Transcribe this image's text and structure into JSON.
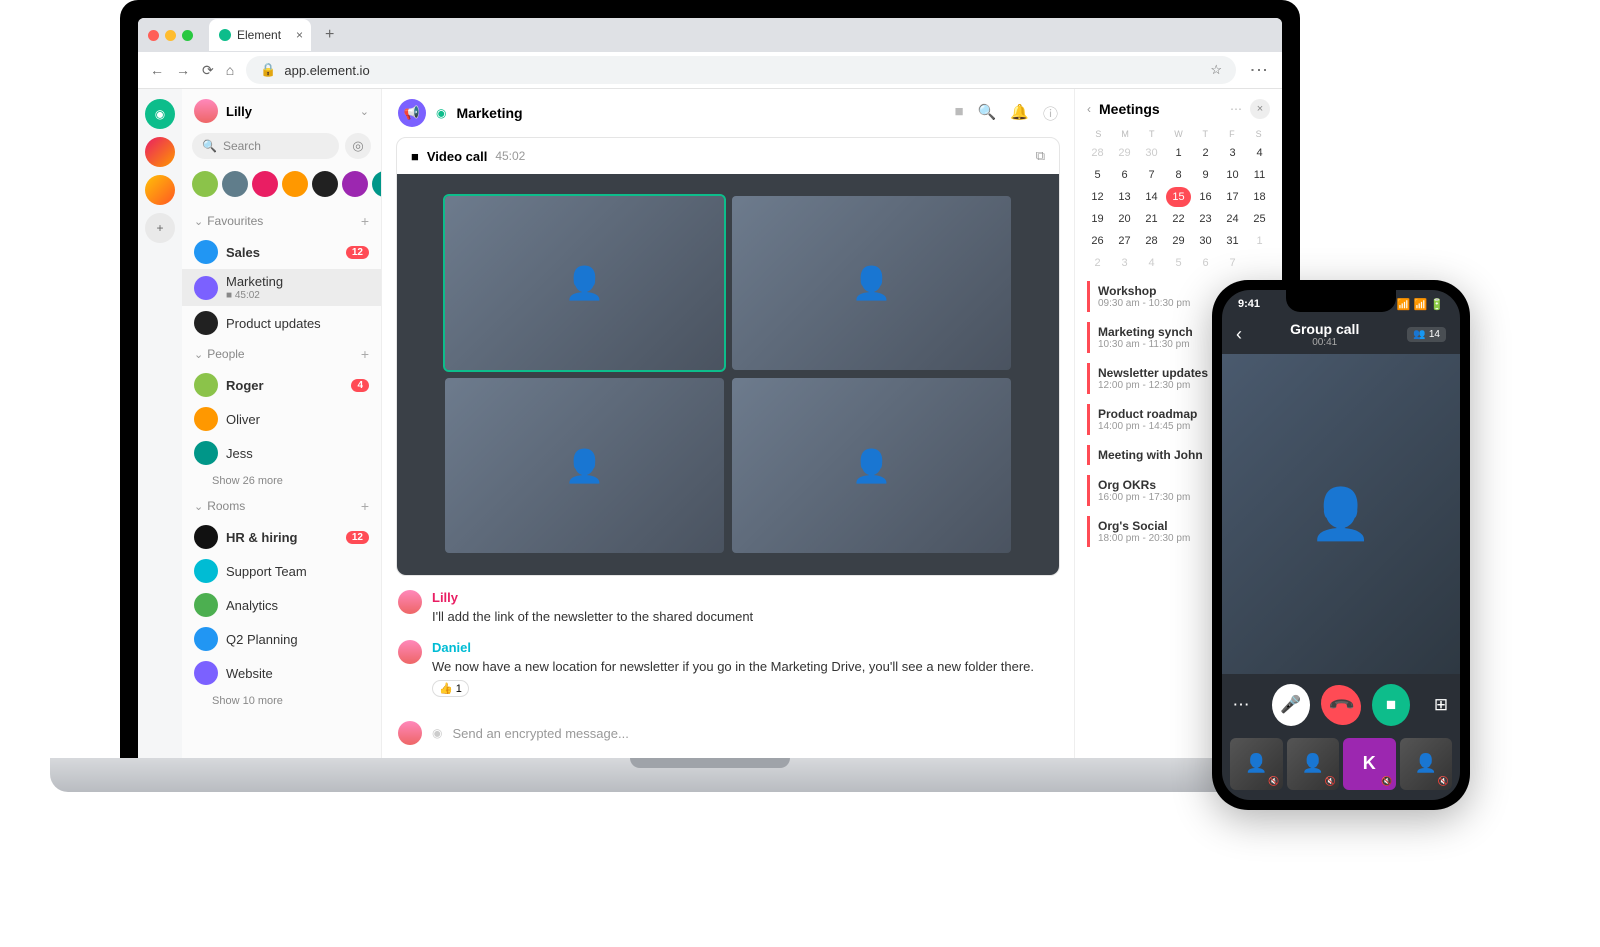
{
  "browser": {
    "tab_title": "Element",
    "url": "app.element.io"
  },
  "user": {
    "name": "Lilly"
  },
  "search": {
    "placeholder": "Search"
  },
  "sections": {
    "favourites": {
      "label": "Favourites",
      "items": [
        {
          "name": "Sales",
          "badge": "12",
          "bold": true
        },
        {
          "name": "Marketing",
          "sub": "■ 45:02",
          "selected": true
        },
        {
          "name": "Product updates"
        }
      ]
    },
    "people": {
      "label": "People",
      "items": [
        {
          "name": "Roger",
          "badge": "4",
          "bold": true
        },
        {
          "name": "Oliver"
        },
        {
          "name": "Jess"
        }
      ],
      "more": "Show 26 more"
    },
    "rooms": {
      "label": "Rooms",
      "items": [
        {
          "name": "HR & hiring",
          "badge": "12",
          "bold": true
        },
        {
          "name": "Support Team"
        },
        {
          "name": "Analytics"
        },
        {
          "name": "Q2 Planning"
        },
        {
          "name": "Website"
        }
      ],
      "more": "Show 10 more"
    }
  },
  "room_header": {
    "title": "Marketing"
  },
  "video_call": {
    "label": "Video call",
    "duration": "45:02"
  },
  "messages": [
    {
      "sender": "Lilly",
      "color": "pink",
      "text": "I'll add the link of the newsletter to the shared document"
    },
    {
      "sender": "Daniel",
      "color": "teal",
      "text": "We now have a new location for newsletter if you go in the Marketing Drive, you'll see a new folder there.",
      "reaction": "👍 1"
    }
  ],
  "composer": {
    "placeholder": "Send an encrypted message..."
  },
  "meetings": {
    "title": "Meetings",
    "dow": [
      "S",
      "M",
      "T",
      "W",
      "T",
      "F",
      "S"
    ],
    "days_prev": [
      28,
      29,
      30
    ],
    "days": [
      1,
      2,
      3,
      4,
      5,
      6,
      7,
      8,
      9,
      10,
      11,
      12,
      13,
      14,
      15,
      16,
      17,
      18,
      19,
      20,
      21,
      22,
      23,
      24,
      25,
      26,
      27,
      28,
      29,
      30,
      31
    ],
    "days_next": [
      1,
      2,
      3,
      4,
      5,
      6,
      7
    ],
    "today": 15,
    "events": [
      {
        "t": "Workshop",
        "time": "09:30 am - 10:30 pm"
      },
      {
        "t": "Marketing synch",
        "time": "10:30 am - 11:30 pm"
      },
      {
        "t": "Newsletter updates",
        "time": "12:00 pm - 12:30 pm"
      },
      {
        "t": "Product roadmap",
        "time": "14:00 pm - 14:45 pm"
      },
      {
        "t": "Meeting with John",
        "time": ""
      },
      {
        "t": "Org OKRs",
        "time": "16:00 pm - 17:30 pm"
      },
      {
        "t": "Org's Social",
        "time": "18:00 pm - 20:30 pm"
      }
    ]
  },
  "phone": {
    "time": "9:41",
    "title": "Group call",
    "duration": "00:41",
    "participants": "14",
    "thumb_letter": "K"
  }
}
